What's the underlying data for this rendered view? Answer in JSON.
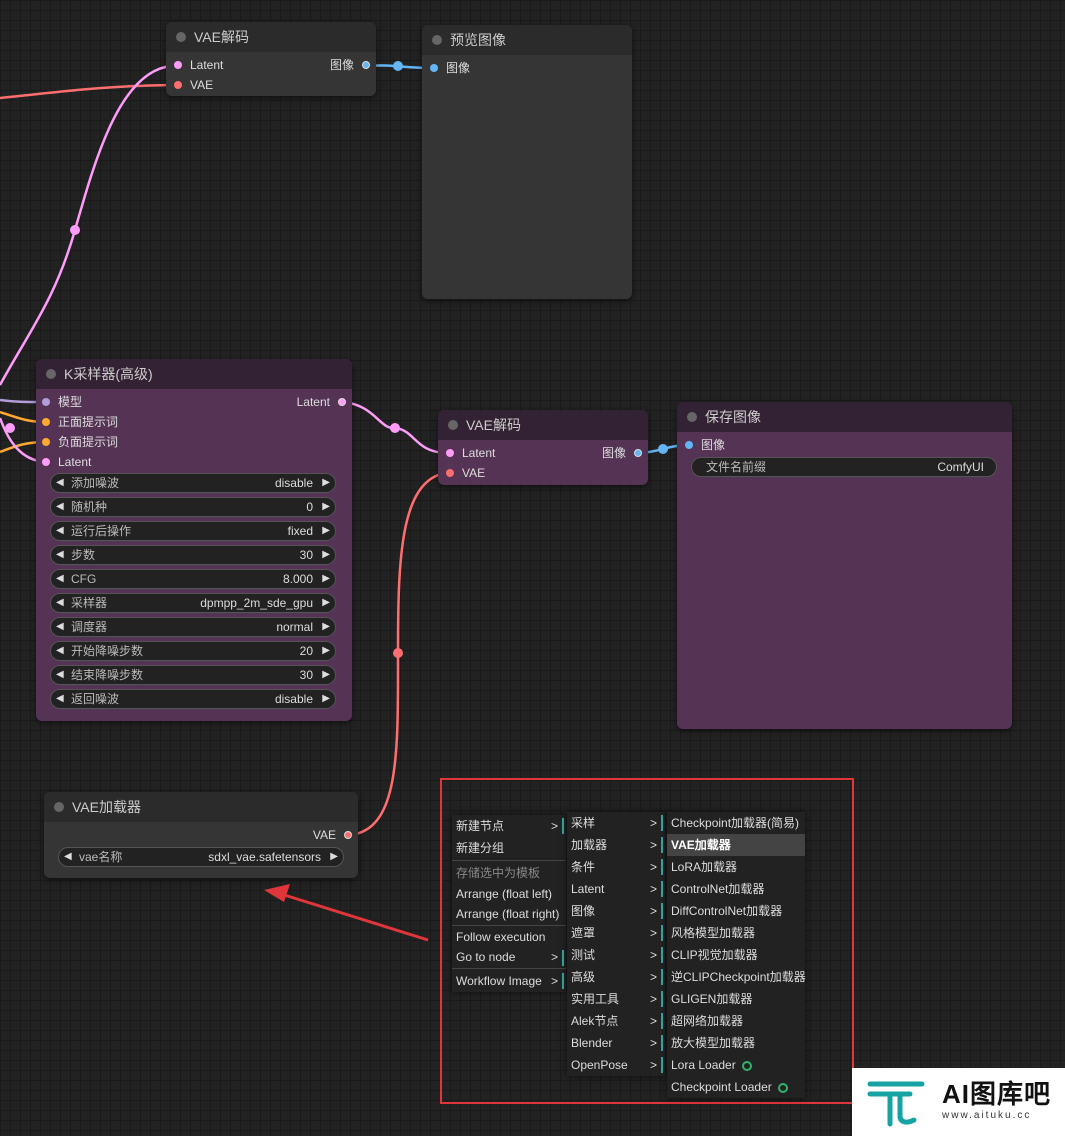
{
  "colors": {
    "latent": "#ff9cf9",
    "vae": "#ff6e6e",
    "image": "#64b5f6",
    "model": "#b39ddb",
    "conditioning": "#ffa931",
    "annotation": "#e0353a",
    "submenu_marker": "#3aa6a6"
  },
  "vae_decode_top": {
    "title": "VAE解码",
    "inputs": [
      "Latent",
      "VAE"
    ],
    "output": "图像"
  },
  "preview_image": {
    "title": "预览图像",
    "input": "图像"
  },
  "ksampler": {
    "title": "K采样器(高级)",
    "inputs": [
      "模型",
      "正面提示词",
      "负面提示词",
      "Latent"
    ],
    "output": "Latent",
    "widgets": [
      {
        "label": "添加噪波",
        "value": "disable"
      },
      {
        "label": "随机种",
        "value": "0"
      },
      {
        "label": "运行后操作",
        "value": "fixed"
      },
      {
        "label": "步数",
        "value": "30"
      },
      {
        "label": "CFG",
        "value": "8.000"
      },
      {
        "label": "采样器",
        "value": "dpmpp_2m_sde_gpu"
      },
      {
        "label": "调度器",
        "value": "normal"
      },
      {
        "label": "开始降噪步数",
        "value": "20"
      },
      {
        "label": "结束降噪步数",
        "value": "30"
      },
      {
        "label": "返回噪波",
        "value": "disable"
      }
    ]
  },
  "vae_decode_mid": {
    "title": "VAE解码",
    "inputs": [
      "Latent",
      "VAE"
    ],
    "output": "图像"
  },
  "save_image": {
    "title": "保存图像",
    "input": "图像",
    "widget": {
      "label": "文件名前缀",
      "value": "ComfyUI"
    }
  },
  "vae_loader": {
    "title": "VAE加载器",
    "output": "VAE",
    "widget": {
      "label": "vae名称",
      "value": "sdxl_vae.safetensors"
    }
  },
  "context_menu": {
    "items": [
      "新建节点",
      "新建分组",
      "存储选中为模板",
      "Arrange (float left)",
      "Arrange (float right)",
      "Follow execution",
      "Go to node",
      "Workflow Image"
    ]
  },
  "submenu_1": {
    "items": [
      "采样",
      "加载器",
      "条件",
      "Latent",
      "图像",
      "遮罩",
      "测试",
      "高级",
      "实用工具",
      "Alek节点",
      "Blender",
      "OpenPose"
    ]
  },
  "submenu_2": {
    "items": [
      "Checkpoint加载器(简易)",
      "VAE加载器",
      "LoRA加载器",
      "ControlNet加载器",
      "DiffControlNet加载器",
      "风格模型加载器",
      "CLIP视觉加载器",
      "逆CLIPCheckpoint加载器",
      "GLIGEN加载器",
      "超网络加载器",
      "放大模型加载器",
      "Lora Loader",
      "Checkpoint Loader"
    ]
  },
  "watermark": {
    "title": "AI图库吧",
    "url": "www.aituku.cc"
  }
}
